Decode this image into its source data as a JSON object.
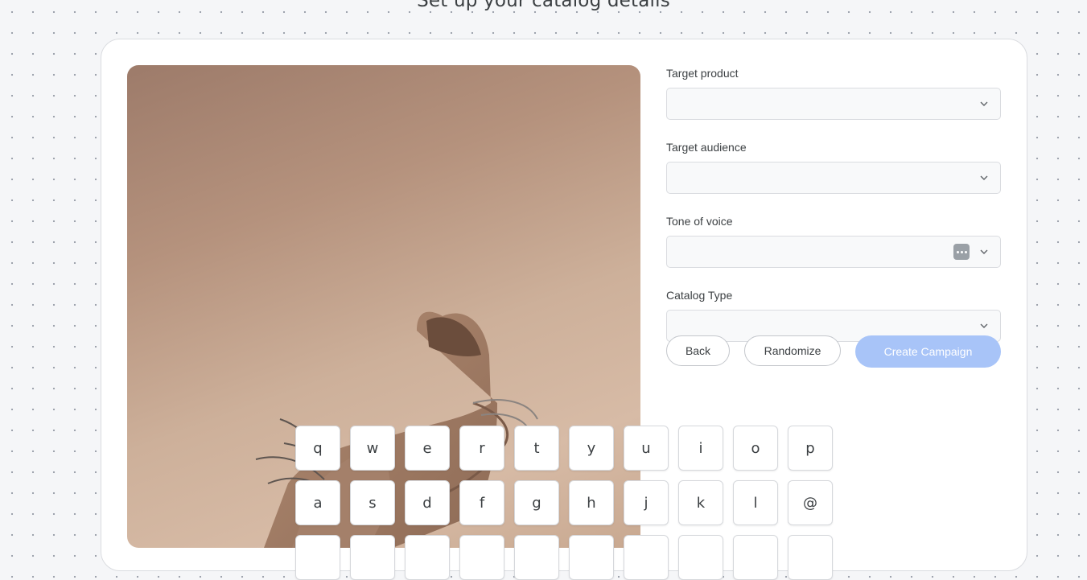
{
  "page": {
    "title": "Set up your catalog details"
  },
  "form": {
    "fields": [
      {
        "label": "Target product",
        "value": ""
      },
      {
        "label": "Target audience",
        "value": ""
      },
      {
        "label": "Tone of voice",
        "value": ""
      },
      {
        "label": "Catalog Type",
        "value": ""
      }
    ],
    "buttons": {
      "back": "Back",
      "randomize": "Randomize",
      "create": "Create Campaign"
    }
  },
  "keyboard": {
    "row1": [
      "q",
      "w",
      "e",
      "r",
      "t",
      "y",
      "u",
      "i",
      "o",
      "p"
    ],
    "row2": [
      "a",
      "s",
      "d",
      "f",
      "g",
      "h",
      "j",
      "k",
      "l",
      "@"
    ]
  },
  "colors": {
    "primary_disabled": "#a8c4f8",
    "card_border": "#dadce0"
  }
}
